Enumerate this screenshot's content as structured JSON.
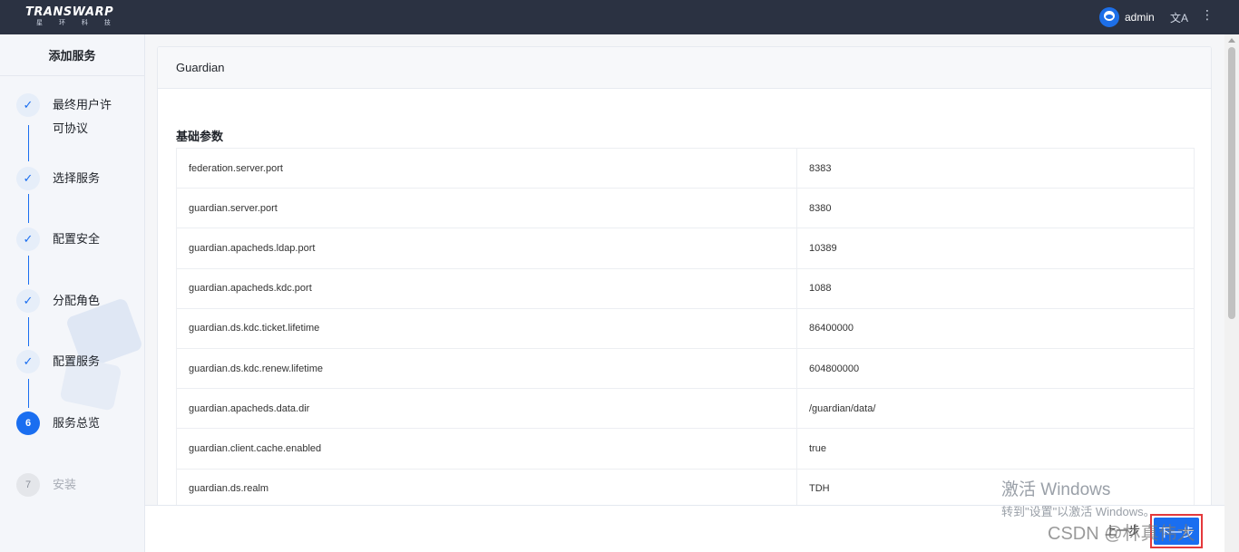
{
  "app": {
    "brand": "TRANSWARP",
    "brand_sub": "星 环 科 技",
    "user": "admin",
    "lang_icon": "translate-icon",
    "more_icon": "vertical-dots-icon"
  },
  "sidebar": {
    "title": "添加服务",
    "steps": [
      {
        "num": "✓",
        "label": "最终用户许可协议",
        "state": "done"
      },
      {
        "num": "✓",
        "label": "选择服务",
        "state": "done"
      },
      {
        "num": "✓",
        "label": "配置安全",
        "state": "done"
      },
      {
        "num": "✓",
        "label": "分配角色",
        "state": "done"
      },
      {
        "num": "✓",
        "label": "配置服务",
        "state": "done"
      },
      {
        "num": "6",
        "label": "服务总览",
        "state": "active"
      },
      {
        "num": "7",
        "label": "安装",
        "state": "todo"
      }
    ]
  },
  "main": {
    "card_title": "Guardian",
    "section_title": "基础参数",
    "params": [
      {
        "key": "federation.server.port",
        "value": "8383"
      },
      {
        "key": "guardian.server.port",
        "value": "8380"
      },
      {
        "key": "guardian.apacheds.ldap.port",
        "value": "10389"
      },
      {
        "key": "guardian.apacheds.kdc.port",
        "value": "1088"
      },
      {
        "key": "guardian.ds.kdc.ticket.lifetime",
        "value": "86400000"
      },
      {
        "key": "guardian.ds.kdc.renew.lifetime",
        "value": "604800000"
      },
      {
        "key": "guardian.apacheds.data.dir",
        "value": "/guardian/data/"
      },
      {
        "key": "guardian.client.cache.enabled",
        "value": "true"
      },
      {
        "key": "guardian.ds.realm",
        "value": "TDH"
      }
    ]
  },
  "footer": {
    "prev_label": "上一步",
    "next_label": "下一步"
  },
  "overlay": {
    "activate_title": "激活 Windows",
    "activate_sub": "转到\"设置\"以激活 Windows。",
    "watermark": "CSDN @林真伟大"
  }
}
